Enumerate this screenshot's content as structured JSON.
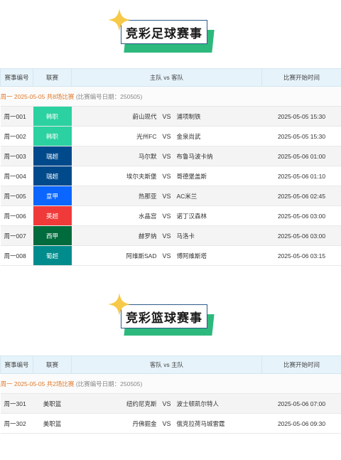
{
  "football": {
    "title": "竞彩足球赛事",
    "headers": [
      "赛事编号",
      "联赛",
      "主队 vs 客队",
      "比赛开始时间"
    ],
    "date_label": "周一 2025-05-05 共8场比赛",
    "date_note": "(比赛编号日期：250505)",
    "matches": [
      {
        "num": "周一001",
        "league": "韩职",
        "color": "#2bd1a0",
        "home": "蔚山现代",
        "away": "浦项制铁",
        "time": "2025-05-05 15:30"
      },
      {
        "num": "周一002",
        "league": "韩职",
        "color": "#2bd1a0",
        "home": "光州FC",
        "away": "金泉尚武",
        "time": "2025-05-05 15:30"
      },
      {
        "num": "周一003",
        "league": "瑞超",
        "color": "#004a8c",
        "home": "马尔默",
        "away": "布鲁马波卡纳",
        "time": "2025-05-06 01:00"
      },
      {
        "num": "周一004",
        "league": "瑞超",
        "color": "#004a8c",
        "home": "埃尔夫斯堡",
        "away": "哥德堡盖斯",
        "time": "2025-05-06 01:10"
      },
      {
        "num": "周一005",
        "league": "意甲",
        "color": "#0a66ff",
        "home": "热那亚",
        "away": "AC米兰",
        "time": "2025-05-06 02:45"
      },
      {
        "num": "周一006",
        "league": "英超",
        "color": "#f03a3a",
        "home": "水晶宫",
        "away": "诺丁汉森林",
        "time": "2025-05-06 03:00"
      },
      {
        "num": "周一007",
        "league": "西甲",
        "color": "#006b3c",
        "home": "赫罗纳",
        "away": "马洛卡",
        "time": "2025-05-06 03:00"
      },
      {
        "num": "周一008",
        "league": "葡超",
        "color": "#008c8c",
        "home": "阿维斯SAD",
        "away": "博阿维斯塔",
        "time": "2025-05-06 03:15"
      }
    ]
  },
  "basketball": {
    "title": "竞彩篮球赛事",
    "headers": [
      "赛事编号",
      "联赛",
      "客队 vs 主队",
      "比赛开始时间"
    ],
    "date_label": "周一 2025-05-05 共2场比赛",
    "date_note": "(比赛编号日期：250505)",
    "matches": [
      {
        "num": "周一301",
        "league": "美职篮",
        "home": "纽约尼克斯",
        "away": "波士顿凯尔特人",
        "time": "2025-05-06 07:00"
      },
      {
        "num": "周一302",
        "league": "美职篮",
        "home": "丹佛掘金",
        "away": "俄克拉荷马城雷霆",
        "time": "2025-05-06 09:30"
      }
    ]
  },
  "vs_label": "VS",
  "colors": {
    "accent_green": "#2db97d",
    "sparkle": "#f7c948",
    "header_bg": "#e6f3fb",
    "date_orange": "#e07a2c"
  }
}
